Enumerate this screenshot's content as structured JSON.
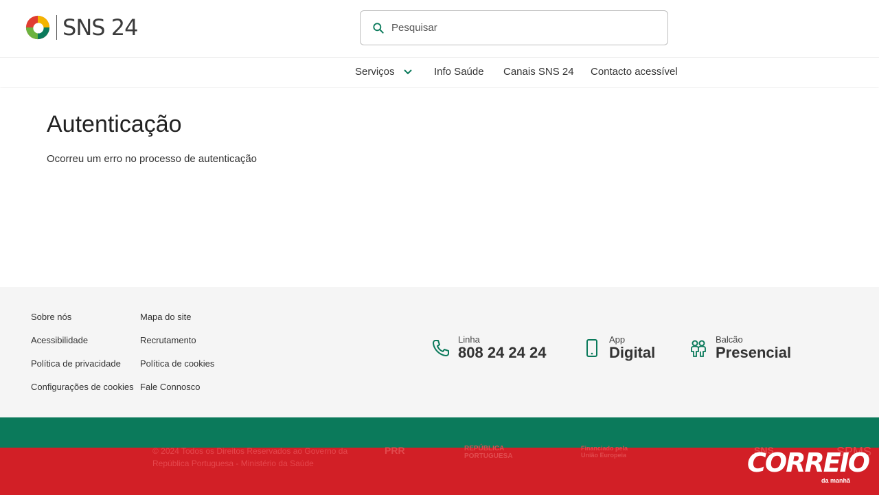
{
  "header": {
    "brand": "SNS 24",
    "search_placeholder": "Pesquisar"
  },
  "nav": {
    "items": [
      "Serviços",
      "Info Saúde",
      "Canais SNS 24",
      "Contacto acessível"
    ]
  },
  "main": {
    "title": "Autenticação",
    "message": "Ocorreu um erro no processo de autenticação"
  },
  "footer": {
    "links_col1": [
      "Sobre nós",
      "Acessibilidade",
      "Política de privacidade",
      "Configurações de cookies"
    ],
    "links_col2": [
      "Mapa do site",
      "Recrutamento",
      "Política de cookies",
      "Fale Connosco"
    ],
    "channels": [
      {
        "small": "Linha",
        "big": "808 24 24 24",
        "icon": "phone-icon"
      },
      {
        "small": "App",
        "big": "Digital",
        "icon": "smartphone-icon"
      },
      {
        "small": "Balcão",
        "big": "Presencial",
        "icon": "people-icon"
      }
    ],
    "copyright": "© 2024 Todos os Direitos Reservados ao Governo da República Portuguesa - Ministério da Saúde",
    "partners": [
      "PRR",
      "REPÚBLICA PORTUGUESA",
      "Financiado pela União Europeia",
      "SNS",
      "SPMS"
    ]
  },
  "overlay": {
    "watermark": "CORREIO",
    "watermark_sub": "da manhã"
  },
  "colors": {
    "brand_green": "#0b7a5b",
    "overlay_red": "#d21f26"
  }
}
